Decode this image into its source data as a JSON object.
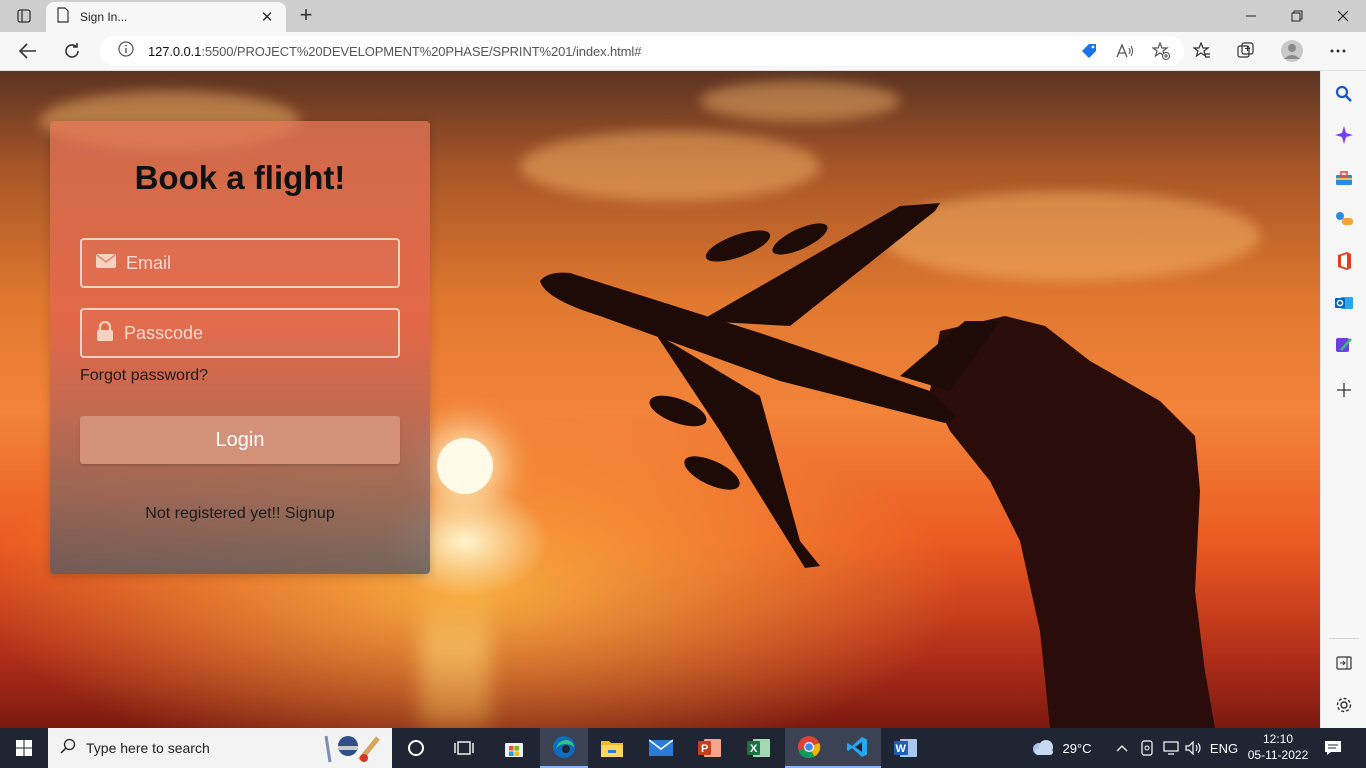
{
  "browser": {
    "tab_title": "Sign In...",
    "tab_close": "✕",
    "new_tab": "+",
    "url_host": "127.0.0.1",
    "url_rest": ":5500/PROJECT%20DEVELOPMENT%20PHASE/SPRINT%201/index.html#"
  },
  "page": {
    "title": "Book a flight!",
    "email_placeholder": "Email",
    "passcode_placeholder": "Passcode",
    "forgot_password": "Forgot password?",
    "login_label": "Login",
    "signup_prefix": "Not registered yet!!",
    "signup_link": "Signup"
  },
  "taskbar": {
    "search_placeholder": "Type here to search",
    "temperature": "29°C",
    "language": "ENG",
    "time": "12:10",
    "date": "05-11-2022"
  },
  "colors": {
    "card_top": "#e6785a",
    "login_button": "#d39179",
    "taskbar": "#1f2533",
    "edge_accent": "#0f6cbd"
  }
}
